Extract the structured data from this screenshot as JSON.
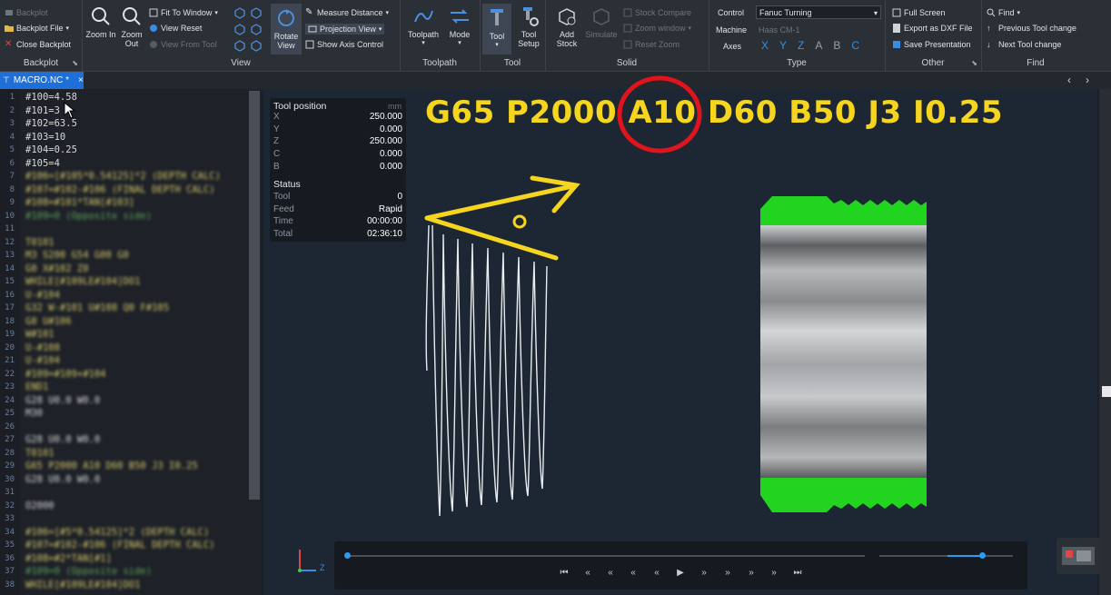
{
  "ribbon": {
    "backplot_group": {
      "backplot": "Backplot",
      "backplot_file": "Backplot File",
      "close_backplot": "Close Backplot",
      "label": "Backplot"
    },
    "view_group": {
      "zoom_in": "Zoom In",
      "zoom_out": "Zoom Out",
      "fit_to_window": "Fit To Window",
      "view_reset": "View Reset",
      "view_from_tool": "View From Tool",
      "rotate_view": "Rotate View",
      "measure_distance": "Measure Distance",
      "projection_view": "Projection View",
      "show_axis_control": "Show Axis Control",
      "label": "View"
    },
    "toolpath_group": {
      "toolpath": "Toolpath",
      "mode": "Mode",
      "label": "Toolpath"
    },
    "tool_group": {
      "tool": "Tool",
      "tool_setup": "Tool Setup",
      "label": "Tool"
    },
    "solid_group": {
      "add_stock": "Add Stock",
      "simulate": "Simulate",
      "stock_compare": "Stock Compare",
      "zoom_window": "Zoom window",
      "reset_zoom": "Reset Zoom",
      "label": "Solid"
    },
    "type_group": {
      "control_label": "Control",
      "control_value": "Fanuc Turning",
      "machine_label": "Machine",
      "machine_value": "Haas CM-1",
      "axes_label": "Axes",
      "axes": [
        "X",
        "Y",
        "Z",
        "A",
        "B",
        "C"
      ],
      "label": "Type"
    },
    "other_group": {
      "full_screen": "Full Screen",
      "export_dxf": "Export as DXF File",
      "save_presentation": "Save Presentation",
      "label": "Other"
    },
    "find_group": {
      "find": "Find",
      "previous_tool_change": "Previous Tool change",
      "next_tool_change": "Next Tool change",
      "label": "Find"
    }
  },
  "tab": {
    "title": "MACRO.NC *",
    "close": "×"
  },
  "editor_lines": [
    {
      "n": "1",
      "t": "#100=4.58",
      "cls": "c-w",
      "blur": false
    },
    {
      "n": "2",
      "t": "#101=3",
      "cls": "c-w",
      "blur": false
    },
    {
      "n": "3",
      "t": "#102=63.5",
      "cls": "c-w",
      "blur": false
    },
    {
      "n": "4",
      "t": "#103=10",
      "cls": "c-w",
      "blur": false
    },
    {
      "n": "5",
      "t": "#104=0.25",
      "cls": "c-w",
      "blur": false
    },
    {
      "n": "6",
      "t": "#105=4",
      "cls": "c-w",
      "blur": false
    },
    {
      "n": "7",
      "t": "#106=[#105*0.54125]*2 (DEPTH CALC)",
      "cls": "c-y",
      "blur": true
    },
    {
      "n": "8",
      "t": "#107=#102-#106 (FINAL DEPTH CALC)",
      "cls": "c-y",
      "blur": true
    },
    {
      "n": "9",
      "t": "#108=#101*TAN[#103]",
      "cls": "c-y",
      "blur": true
    },
    {
      "n": "10",
      "t": "#109=0 (Opposite side)",
      "cls": "c-g",
      "blur": true
    },
    {
      "n": "11",
      "t": "",
      "cls": "c-w",
      "blur": true
    },
    {
      "n": "12",
      "t": "T0101",
      "cls": "c-y",
      "blur": true
    },
    {
      "n": "13",
      "t": "M3 S200 G54 G00 G0",
      "cls": "c-y",
      "blur": true
    },
    {
      "n": "14",
      "t": "G0 X#102 Z0",
      "cls": "c-y",
      "blur": true
    },
    {
      "n": "15",
      "t": "WHILE[#109LE#104]DO1",
      "cls": "c-y",
      "blur": true
    },
    {
      "n": "16",
      "t": "U-#104",
      "cls": "c-y",
      "blur": true
    },
    {
      "n": "17",
      "t": "G32 W-#101 U#108 Q0 F#105",
      "cls": "c-y",
      "blur": true
    },
    {
      "n": "18",
      "t": "G0 U#106",
      "cls": "c-y",
      "blur": true
    },
    {
      "n": "19",
      "t": "W#101",
      "cls": "c-y",
      "blur": true
    },
    {
      "n": "20",
      "t": "U-#108",
      "cls": "c-y",
      "blur": true
    },
    {
      "n": "21",
      "t": "U-#104",
      "cls": "c-y",
      "blur": true
    },
    {
      "n": "22",
      "t": "#109=#109+#104",
      "cls": "c-y",
      "blur": true
    },
    {
      "n": "23",
      "t": "END1",
      "cls": "c-y",
      "blur": true
    },
    {
      "n": "24",
      "t": "G28 U0.0 W0.0",
      "cls": "c-w",
      "blur": true
    },
    {
      "n": "25",
      "t": "M30",
      "cls": "c-w",
      "blur": true
    },
    {
      "n": "26",
      "t": "",
      "cls": "c-w",
      "blur": true
    },
    {
      "n": "27",
      "t": "G28 U0.0 W0.0",
      "cls": "c-w",
      "blur": true
    },
    {
      "n": "28",
      "t": "T0101",
      "cls": "c-y",
      "blur": true
    },
    {
      "n": "29",
      "t": "G65 P2000 A10 D60 B50 J3 I0.25",
      "cls": "c-y",
      "blur": true
    },
    {
      "n": "30",
      "t": "G28 U0.0 W0.0",
      "cls": "c-w",
      "blur": true
    },
    {
      "n": "31",
      "t": "",
      "cls": "c-w",
      "blur": true
    },
    {
      "n": "32",
      "t": "O2000",
      "cls": "c-w",
      "blur": true
    },
    {
      "n": "33",
      "t": "",
      "cls": "c-w",
      "blur": true
    },
    {
      "n": "34",
      "t": "#106=[#5*0.54125]*2 (DEPTH CALC)",
      "cls": "c-y",
      "blur": true
    },
    {
      "n": "35",
      "t": "#107=#102-#106 (FINAL DEPTH CALC)",
      "cls": "c-y",
      "blur": true
    },
    {
      "n": "36",
      "t": "#108=#2*TAN[#1]",
      "cls": "c-y",
      "blur": true
    },
    {
      "n": "37",
      "t": "#109=0 (Opposite side)",
      "cls": "c-g",
      "blur": true
    },
    {
      "n": "38",
      "t": "WHILE[#109LE#104]DO1",
      "cls": "c-y",
      "blur": true
    }
  ],
  "tool_panel": {
    "title": "Tool position",
    "unit": "mm",
    "rows": [
      {
        "label": "X",
        "value": "250.000"
      },
      {
        "label": "Y",
        "value": "0.000"
      },
      {
        "label": "Z",
        "value": "250.000"
      },
      {
        "label": "C",
        "value": "0.000"
      },
      {
        "label": "B",
        "value": "0.000"
      }
    ],
    "status_title": "Status",
    "status_rows": [
      {
        "label": "Tool",
        "value": "0"
      },
      {
        "label": "Feed",
        "value": "Rapid"
      },
      {
        "label": "Time",
        "value": "00:00:00"
      },
      {
        "label": "Total",
        "value": "02:36:10"
      }
    ]
  },
  "overlay": {
    "gcode_before": "G65 P2000 ",
    "gcode_highlight": "A10",
    "gcode_after": " D60 B50 J3 I0.25",
    "annotation_color": "#f6d51f",
    "circle_color": "#e0141c"
  },
  "axis_indicator": {
    "z_label": "Z"
  },
  "timeline": {
    "progress": 0.0,
    "speed": 0.77
  },
  "colors": {
    "accent": "#1e6fd8",
    "thread_green": "#22d31f"
  }
}
